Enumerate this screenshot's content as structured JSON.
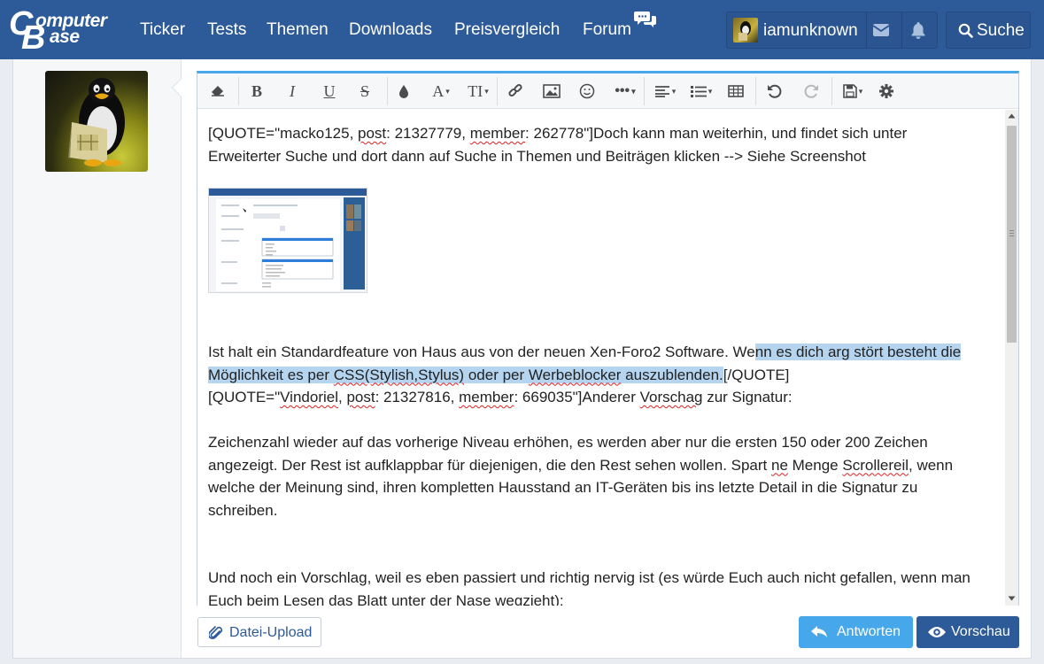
{
  "logo": {
    "line1": "omputer",
    "line2": "ase",
    "c": "C",
    "b": "B",
    "alt": "ComputerBase"
  },
  "nav": {
    "items": [
      "Ticker",
      "Tests",
      "Themen",
      "Downloads",
      "Preisvergleich",
      "Forum"
    ],
    "username": "iamunknown",
    "search_label": "Suche"
  },
  "toolbar": {
    "buttons": [
      "remove-formatting",
      "bold",
      "italic",
      "underline",
      "strikethrough",
      "text-color",
      "font-family",
      "font-size",
      "link",
      "image",
      "smilies",
      "more",
      "align",
      "list",
      "table",
      "undo",
      "redo",
      "drafts",
      "settings"
    ],
    "bold": "B",
    "italic": "I",
    "underline": "U",
    "strike": "S",
    "font": "A",
    "size": "TI"
  },
  "editor": {
    "quote1_pre": "[QUOTE=\"macko125, ",
    "quote1_w1": "post",
    "quote1_mid": ": 21327779, ",
    "quote1_w2": "member",
    "quote1_post": ": 262778\"]Doch kann man weiterhin, und findet sich unter Erweiterter Suche und dort dann auf Suche in Themen und Beiträgen klicken --> Siehe Screenshot",
    "para2_pre": "Ist halt ein Standardfeature von Haus aus von der neuen Xen-Foro2 Software. We",
    "para2_sel_a": "nn es dich arg stört besteht die Möglichkeit es per ",
    "para2_sel_w1": "CSS(Stylish,Stylus)",
    "para2_sel_b": " oder per ",
    "para2_sel_w2": "Werbeblocker",
    "para2_sel_c": " auszublenden.",
    "para2_post": "[/QUOTE]",
    "quote2_pre": "[QUOTE=\"",
    "quote2_w1": "Vindoriel",
    "quote2_c1": ", ",
    "quote2_w2": "post",
    "quote2_mid": ": 21327816, ",
    "quote2_w3": "member",
    "quote2_mid2": ": 669035\"]Anderer ",
    "quote2_w4": "Vorschag",
    "quote2_post": " zur Signatur:",
    "para3_pre": "Zeichenzahl wieder auf das vorherige Niveau erhöhen, es werden aber nur die ersten 150 oder 200 Zeichen angezeigt. Der Rest ist aufklappbar für diejenigen, die den Rest sehen wollen. Spart ",
    "para3_w1": "ne",
    "para3_mid": " Menge ",
    "para3_w2": "Scrollereil",
    "para3_post": ", wenn welche der Meinung sind, ihren kompletten Hausstand an IT-Geräten bis ins letzte Detail in die Signatur zu schreiben.",
    "para4": "Und noch ein Vorschlag, weil es eben passiert und richtig nervig ist (es würde Euch auch nicht gefallen, wenn man Euch beim Lesen das Blatt unter der Nase wegzieht):"
  },
  "actions": {
    "upload": "Datei-Upload",
    "reply": "Antworten",
    "preview": "Vorschau"
  },
  "colors": {
    "nav_bg": "#2d5a98",
    "accent": "#47a7eb",
    "primary_button": "#2d5a98",
    "selection": "#b4d4f0"
  }
}
